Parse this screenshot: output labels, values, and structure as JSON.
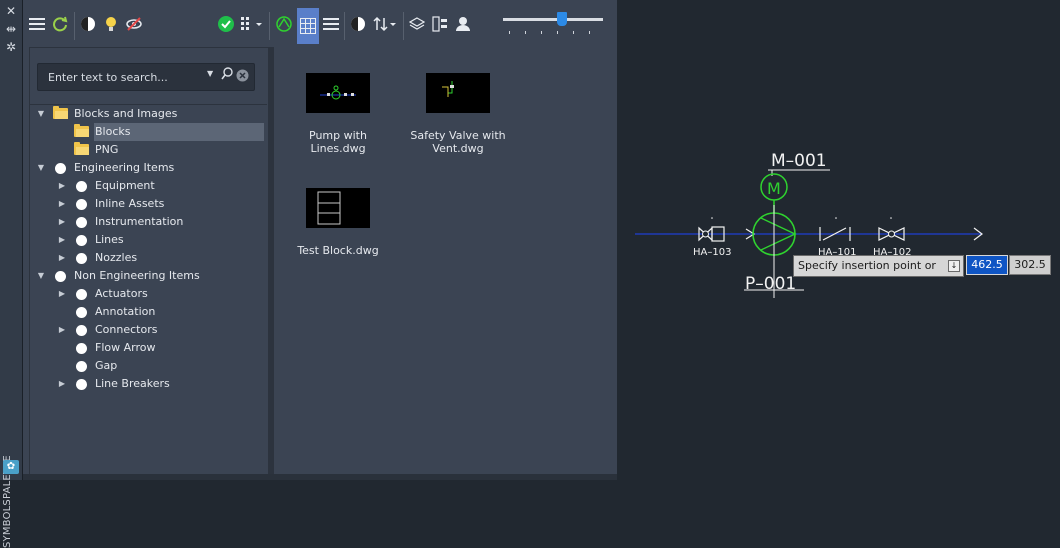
{
  "side_strip": {
    "title": "SYMBOLSPALETTE",
    "icons": [
      "close-icon",
      "collapse-icon",
      "settings-icon",
      "palette-icon"
    ]
  },
  "toolbar": {
    "icons": [
      "menu-icon",
      "refresh-icon",
      "contrast-icon",
      "lightbulb-icon",
      "hide-icon",
      "check-icon",
      "grid-options-icon",
      "pipe-icon",
      "thumbnail-view-icon",
      "list-view-icon",
      "contrast-icon",
      "sort-icon",
      "layers-icon",
      "text-block-icon",
      "user-icon"
    ],
    "slider_level": 0.6
  },
  "search": {
    "placeholder": "Enter text to search...",
    "value": ""
  },
  "tree": [
    {
      "label": "Blocks and Images",
      "level": 0,
      "expanded": true,
      "icon": "folder"
    },
    {
      "label": "Blocks",
      "level": 1,
      "icon": "folder",
      "selected": true
    },
    {
      "label": "PNG",
      "level": 1,
      "icon": "folder"
    },
    {
      "label": "Engineering Items",
      "level": 0,
      "expanded": true,
      "icon": "dot"
    },
    {
      "label": "Equipment",
      "level": 1,
      "expandable": true,
      "icon": "dot"
    },
    {
      "label": "Inline Assets",
      "level": 1,
      "expandable": true,
      "icon": "dot"
    },
    {
      "label": "Instrumentation",
      "level": 1,
      "expandable": true,
      "icon": "dot"
    },
    {
      "label": "Lines",
      "level": 1,
      "expandable": true,
      "icon": "dot"
    },
    {
      "label": "Nozzles",
      "level": 1,
      "expandable": true,
      "icon": "dot"
    },
    {
      "label": "Non Engineering Items",
      "level": 0,
      "expanded": true,
      "icon": "dot"
    },
    {
      "label": "Actuators",
      "level": 1,
      "expandable": true,
      "icon": "dot"
    },
    {
      "label": "Annotation",
      "level": 1,
      "icon": "dot"
    },
    {
      "label": "Connectors",
      "level": 1,
      "expandable": true,
      "icon": "dot"
    },
    {
      "label": "Flow Arrow",
      "level": 1,
      "icon": "dot"
    },
    {
      "label": "Gap",
      "level": 1,
      "icon": "dot"
    },
    {
      "label": "Line Breakers",
      "level": 1,
      "expandable": true,
      "icon": "dot"
    }
  ],
  "thumbnails": [
    {
      "caption_line1": "Pump with Lines.dwg",
      "caption_line2": ""
    },
    {
      "caption_line1": "Safety Valve with",
      "caption_line2": "Vent.dwg"
    },
    {
      "caption_line1": "Test Block.dwg",
      "caption_line2": ""
    }
  ],
  "drawing": {
    "motor_tag": "M–001",
    "pump_tag": "P–001",
    "motor_letter": "M",
    "valve_tags": [
      "HA–103",
      "HA–101",
      "HA–102"
    ],
    "line_color": "#1f3fd1",
    "symbol_color": "#2fd22f",
    "annotation_color": "#f2f2f2"
  },
  "insertion_tooltip": {
    "text": "Specify insertion point or",
    "x_value": "462.5",
    "y_value": "302.5"
  },
  "colors": {
    "panel_bg": "#3b4453",
    "canvas_bg": "#212830",
    "selection": "#5c6676",
    "check_green": "#1fbf4a",
    "folder_yellow": "#f0c44a"
  }
}
